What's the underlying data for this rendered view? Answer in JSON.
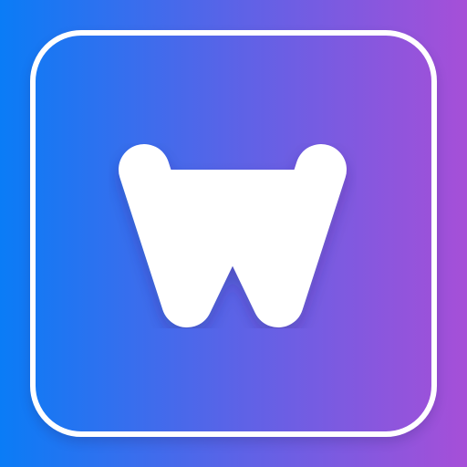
{
  "app_icon": {
    "letter": "W",
    "colors": {
      "gradient_left": "#0a7cf6",
      "gradient_mid": "#5b63e7",
      "gradient_right": "#a64fd8",
      "foreground": "#ffffff"
    },
    "icon_name": "w-letter-app-icon"
  }
}
